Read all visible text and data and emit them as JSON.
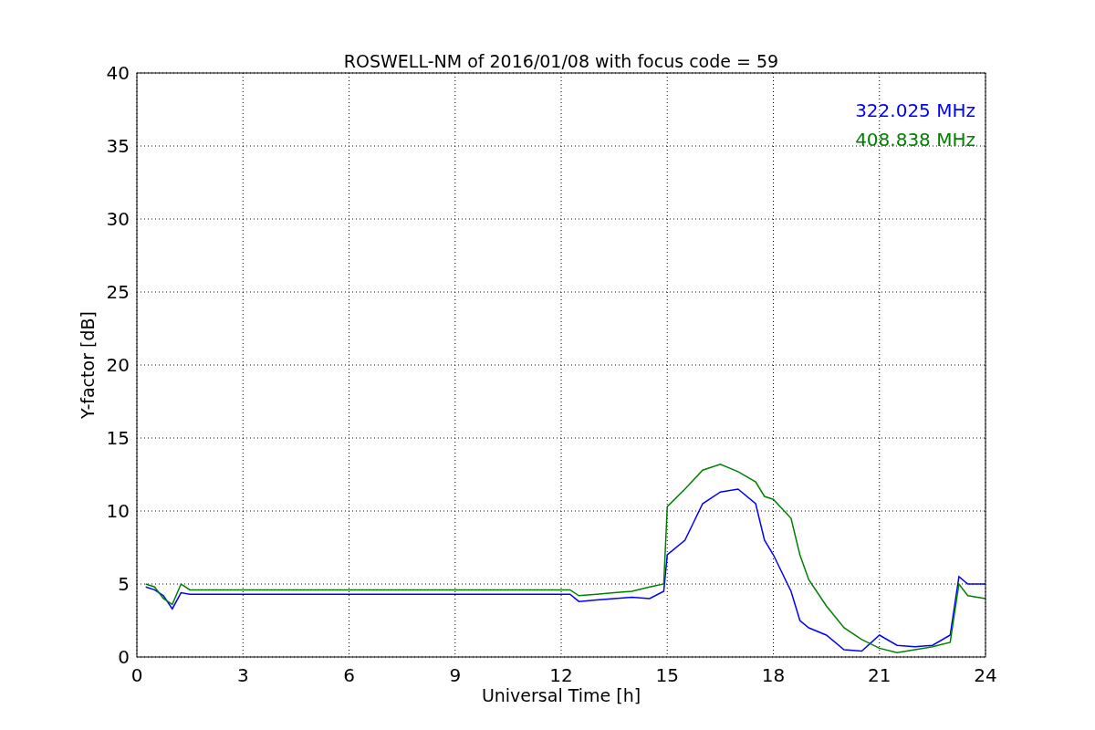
{
  "chart_data": {
    "type": "line",
    "title": "ROSWELL-NM of 2016/01/08 with focus code = 59",
    "xlabel": "Universal Time [h]",
    "ylabel": "Y-factor [dB]",
    "x": [
      0.25,
      0.5,
      0.75,
      1.0,
      1.25,
      1.5,
      12.25,
      12.5,
      13,
      13.5,
      14,
      14.5,
      14.9,
      15,
      15.5,
      16,
      16.5,
      17,
      17.5,
      17.75,
      18,
      18.5,
      18.75,
      19,
      19.5,
      20,
      20.5,
      21,
      21.5,
      22,
      22.5,
      23,
      23.25,
      23.5,
      24
    ],
    "series": [
      {
        "name": "322.025 MHz",
        "color": "#0000ff",
        "values": [
          4.8,
          4.6,
          4.2,
          3.3,
          4.4,
          4.3,
          4.3,
          3.8,
          3.9,
          4.0,
          4.1,
          4.0,
          4.5,
          7.0,
          8.0,
          10.5,
          11.3,
          11.5,
          10.5,
          8.0,
          7.0,
          4.5,
          2.5,
          2.0,
          1.5,
          0.5,
          0.4,
          1.5,
          0.8,
          0.7,
          0.8,
          1.5,
          5.5,
          5.0,
          5.0
        ]
      },
      {
        "name": "408.838 MHz",
        "color": "#008000",
        "values": [
          5.0,
          4.8,
          4.0,
          3.6,
          5.0,
          4.6,
          4.6,
          4.2,
          4.3,
          4.4,
          4.5,
          4.8,
          5.0,
          10.3,
          11.5,
          12.8,
          13.2,
          12.7,
          12.0,
          11.0,
          10.8,
          9.5,
          7.0,
          5.3,
          3.5,
          2.0,
          1.2,
          0.6,
          0.3,
          0.5,
          0.7,
          1.0,
          5.0,
          4.2,
          4.0
        ]
      }
    ],
    "xlim": [
      0,
      24
    ],
    "ylim": [
      0,
      40
    ],
    "xticks": [
      0,
      3,
      6,
      9,
      12,
      15,
      18,
      21,
      24
    ],
    "yticks": [
      0,
      5,
      10,
      15,
      20,
      25,
      30,
      35,
      40
    ],
    "grid": true
  }
}
